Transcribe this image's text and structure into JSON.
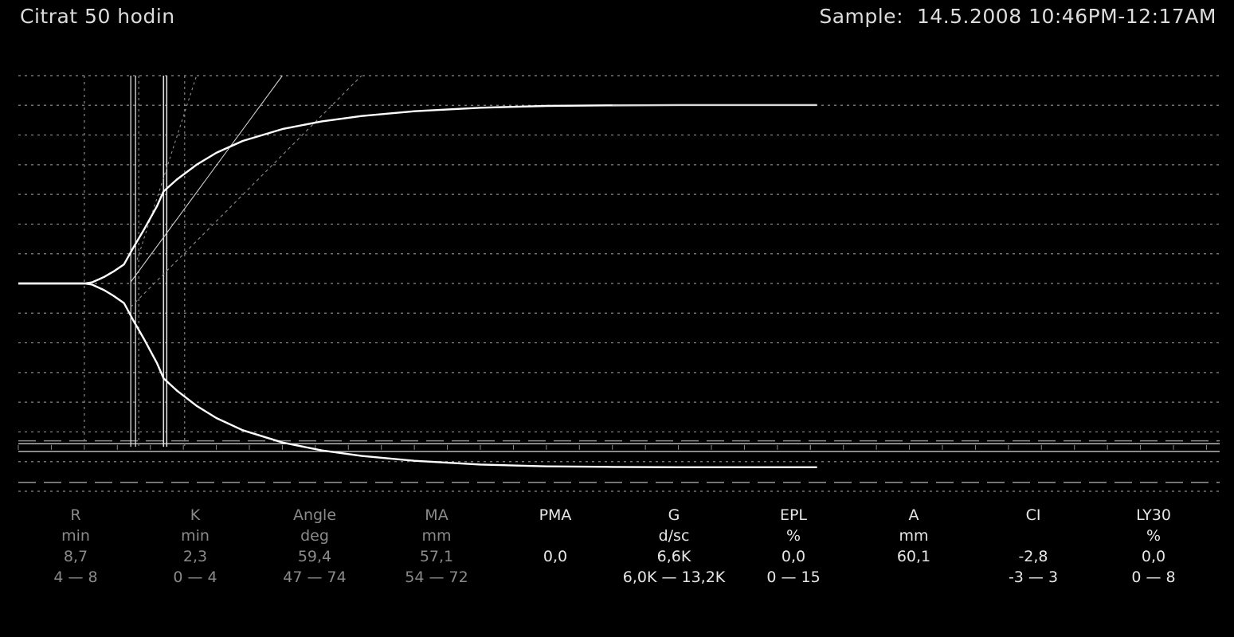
{
  "header": {
    "sample_name": "Citrat 50 hodin",
    "sample_time": "Sample:  14.5.2008 10:46PM-12:17AM"
  },
  "colors": {
    "background": "#000000",
    "trace": "#ffffff",
    "grid": "#8c8c8c",
    "text_normal": "#e6e6e6",
    "text_dim": "#8a8a8a"
  },
  "chart_data": {
    "type": "line",
    "title": "",
    "xlabel": "",
    "ylabel": "",
    "grid": true,
    "x_unit": "min",
    "y_unit": "mm",
    "xlim": [
      0,
      91
    ],
    "ylim": [
      -35,
      35
    ],
    "r_time": 8.7,
    "k_time": 11.0,
    "ma": 57.1,
    "a_final": 60.1,
    "trace_end_time": 60.5,
    "series": [
      {
        "name": "",
        "x": [
          0,
          5,
          5.6,
          6.5,
          7.2,
          8.0,
          8.7,
          9.5,
          10.5,
          11.0,
          12.0,
          13.5,
          15.0,
          17.0,
          20.0,
          23.0,
          26.0,
          30.0,
          35.0,
          40.0,
          45.0,
          50.0,
          55.0,
          60.5
        ],
        "y": [
          0,
          0,
          0.2,
          1.1,
          2.0,
          3.2,
          6.0,
          9.0,
          13.0,
          15.5,
          17.5,
          20.0,
          22.0,
          24.0,
          26.0,
          27.3,
          28.2,
          29.0,
          29.6,
          29.9,
          30.0,
          30.05,
          30.05,
          30.05
        ]
      }
    ],
    "params": [
      {
        "name": "R",
        "unit": "min",
        "value": "8,7",
        "range": "4 — 8",
        "dim": true
      },
      {
        "name": "K",
        "unit": "min",
        "value": "2,3",
        "range": "0 — 4",
        "dim": true
      },
      {
        "name": "Angle",
        "unit": "deg",
        "value": "59,4",
        "range": "47 — 74",
        "dim": true
      },
      {
        "name": "MA",
        "unit": "mm",
        "value": "57,1",
        "range": "54 — 72",
        "dim": true
      },
      {
        "name": "PMA",
        "unit": "",
        "value": "0,0",
        "range": "",
        "dim": false
      },
      {
        "name": "G",
        "unit": "d/sc",
        "value": "6,6K",
        "range": "6,0K — 13,2K",
        "dim": false
      },
      {
        "name": "EPL",
        "unit": "%",
        "value": "0,0",
        "range": "0 — 15",
        "dim": false
      },
      {
        "name": "A",
        "unit": "mm",
        "value": "60,1",
        "range": "",
        "dim": false
      },
      {
        "name": "CI",
        "unit": "",
        "value": "-2,8",
        "range": "-3 — 3",
        "dim": false
      },
      {
        "name": "LY30",
        "unit": "%",
        "value": "0,0",
        "range": "0 — 8",
        "dim": false
      }
    ]
  }
}
